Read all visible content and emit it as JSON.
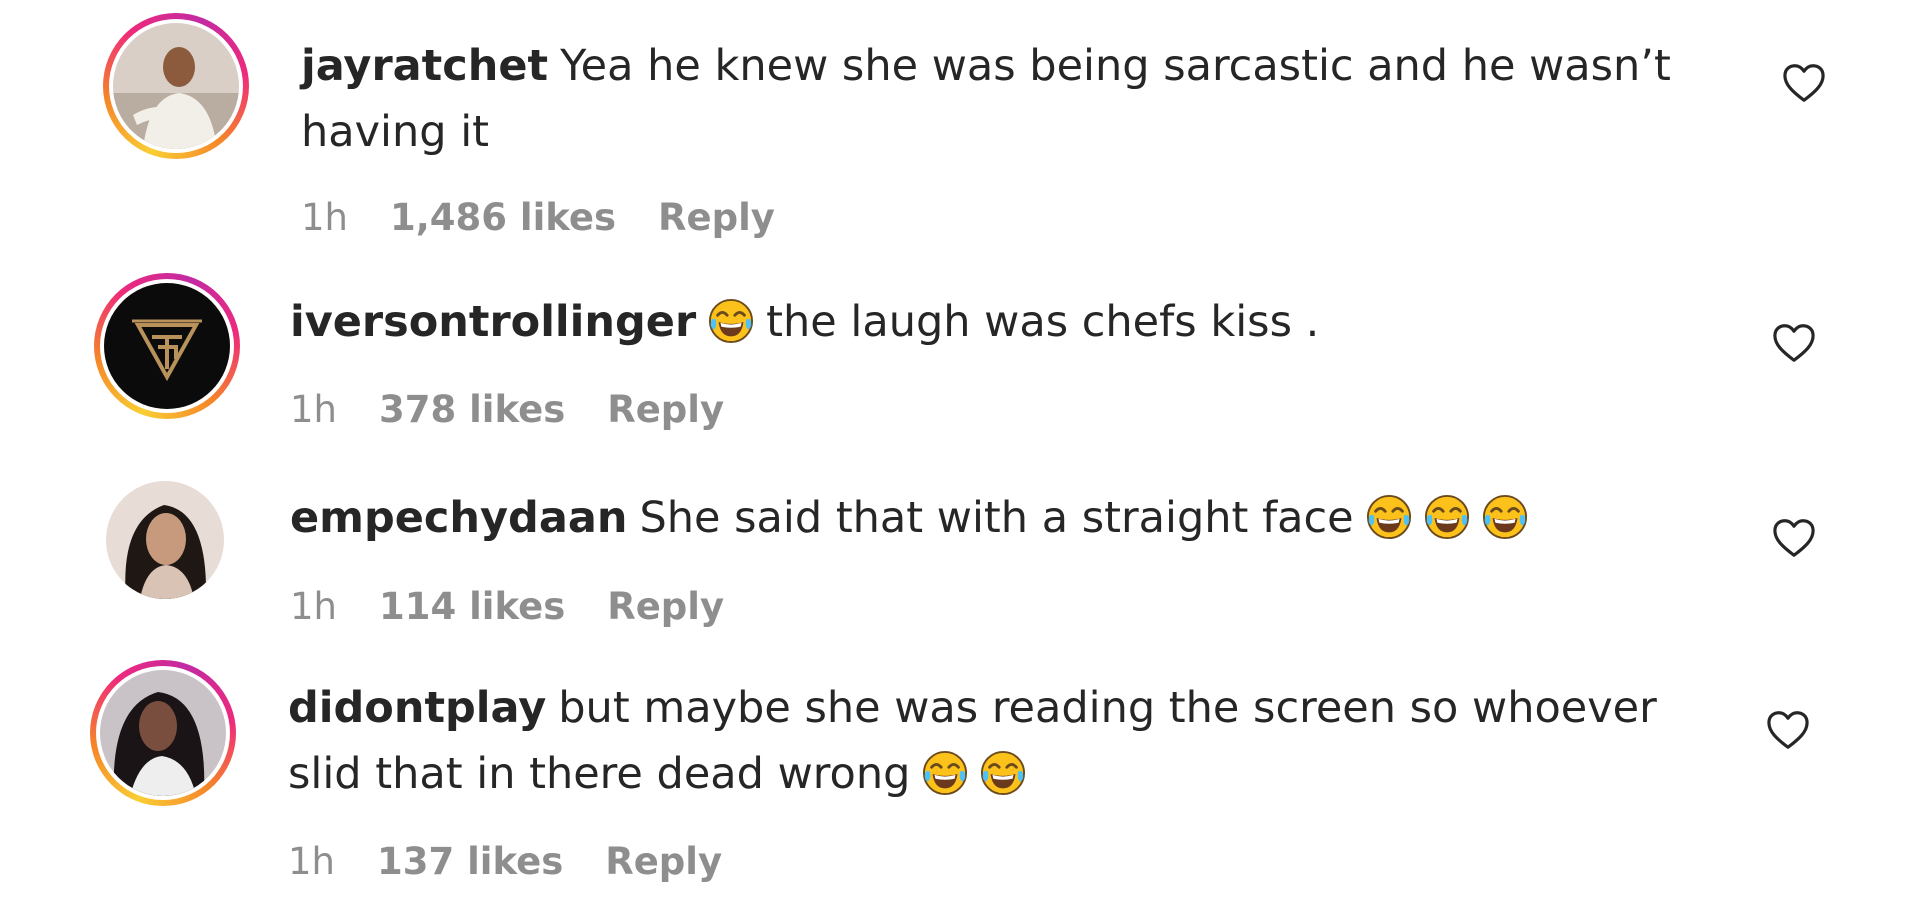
{
  "comments": [
    {
      "username": "jayratchet",
      "text_line1": "Yea he knew she was being sarcastic and he wasn’t",
      "text_line2": "having it",
      "emoji_count": 0,
      "time": "1h",
      "likes": "1,486 likes",
      "reply": "Reply"
    },
    {
      "username": "iversontrollinger",
      "text_line1": "the laugh was chefs kiss .",
      "emoji_before_text": "face-with-tears-of-joy",
      "time": "1h",
      "likes": "378 likes",
      "reply": "Reply"
    },
    {
      "username": "empechydaan",
      "text_line1": "She said that with a straight face",
      "emoji_after_text_count": 3,
      "time": "1h",
      "likes": "114 likes",
      "reply": "Reply"
    },
    {
      "username": "didontplay",
      "text_line1": "but maybe she was reading the screen so whoever",
      "text_line2": "slid that in there dead wrong",
      "emoji_after_text_count": 2,
      "time": "1h",
      "likes": "137 likes",
      "reply": "Reply"
    }
  ],
  "icons": {
    "like": "heart-outline-icon",
    "emoji": "face-with-tears-of-joy"
  },
  "colors": {
    "text": "#262626",
    "meta": "#8e8e8e",
    "story_ring_start": "#f9ce34",
    "story_ring_end": "#c32aa3"
  }
}
